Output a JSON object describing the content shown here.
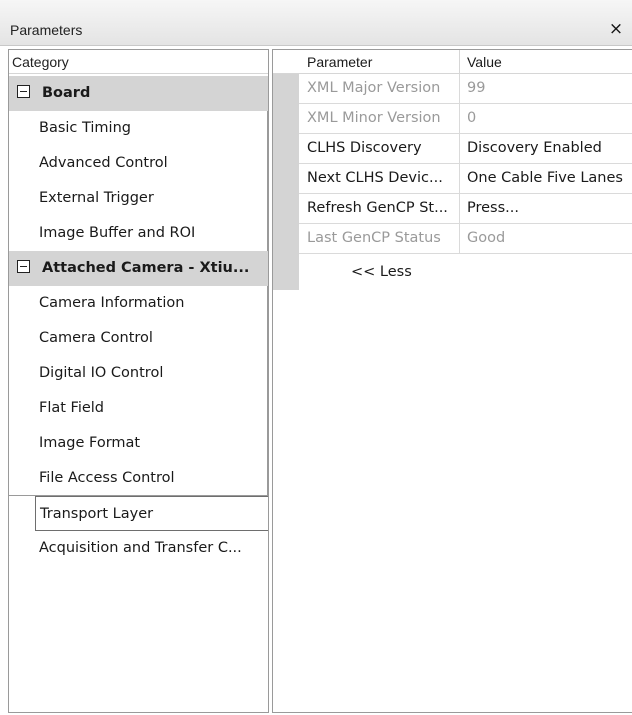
{
  "window": {
    "title": "Parameters",
    "close_glyph": "×"
  },
  "categories": {
    "header": "Category",
    "items": [
      {
        "label": "Board",
        "type": "group"
      },
      {
        "label": "Basic Timing"
      },
      {
        "label": "Advanced Control"
      },
      {
        "label": "External Trigger"
      },
      {
        "label": "Image Buffer and ROI"
      },
      {
        "label": "Attached Camera - Xtiu...",
        "type": "group"
      },
      {
        "label": "Camera Information"
      },
      {
        "label": "Camera Control"
      },
      {
        "label": "Digital IO Control"
      },
      {
        "label": "Flat Field"
      },
      {
        "label": "Image Format"
      },
      {
        "label": "File Access Control"
      },
      {
        "label": "Transport Layer",
        "selected": true
      },
      {
        "label": "Acquisition and Transfer C..."
      }
    ]
  },
  "grid": {
    "headers": {
      "parameter": "Parameter",
      "value": "Value"
    },
    "rows": [
      {
        "parameter": "XML Major Version",
        "value": "99",
        "enabled": false
      },
      {
        "parameter": "XML Minor Version",
        "value": "0",
        "enabled": false
      },
      {
        "parameter": "CLHS Discovery",
        "value": "Discovery Enabled",
        "enabled": true
      },
      {
        "parameter": "Next CLHS Devic...",
        "value": "One Cable Five Lanes",
        "enabled": true
      },
      {
        "parameter": "Refresh GenCP St...",
        "value": "Press...",
        "enabled": true
      },
      {
        "parameter": "Last GenCP Status",
        "value": "Good",
        "enabled": false
      }
    ],
    "less_label": "<< Less"
  },
  "colors": {
    "group_bg": "#d4d4d4",
    "disabled_text": "#9a9a9a"
  }
}
